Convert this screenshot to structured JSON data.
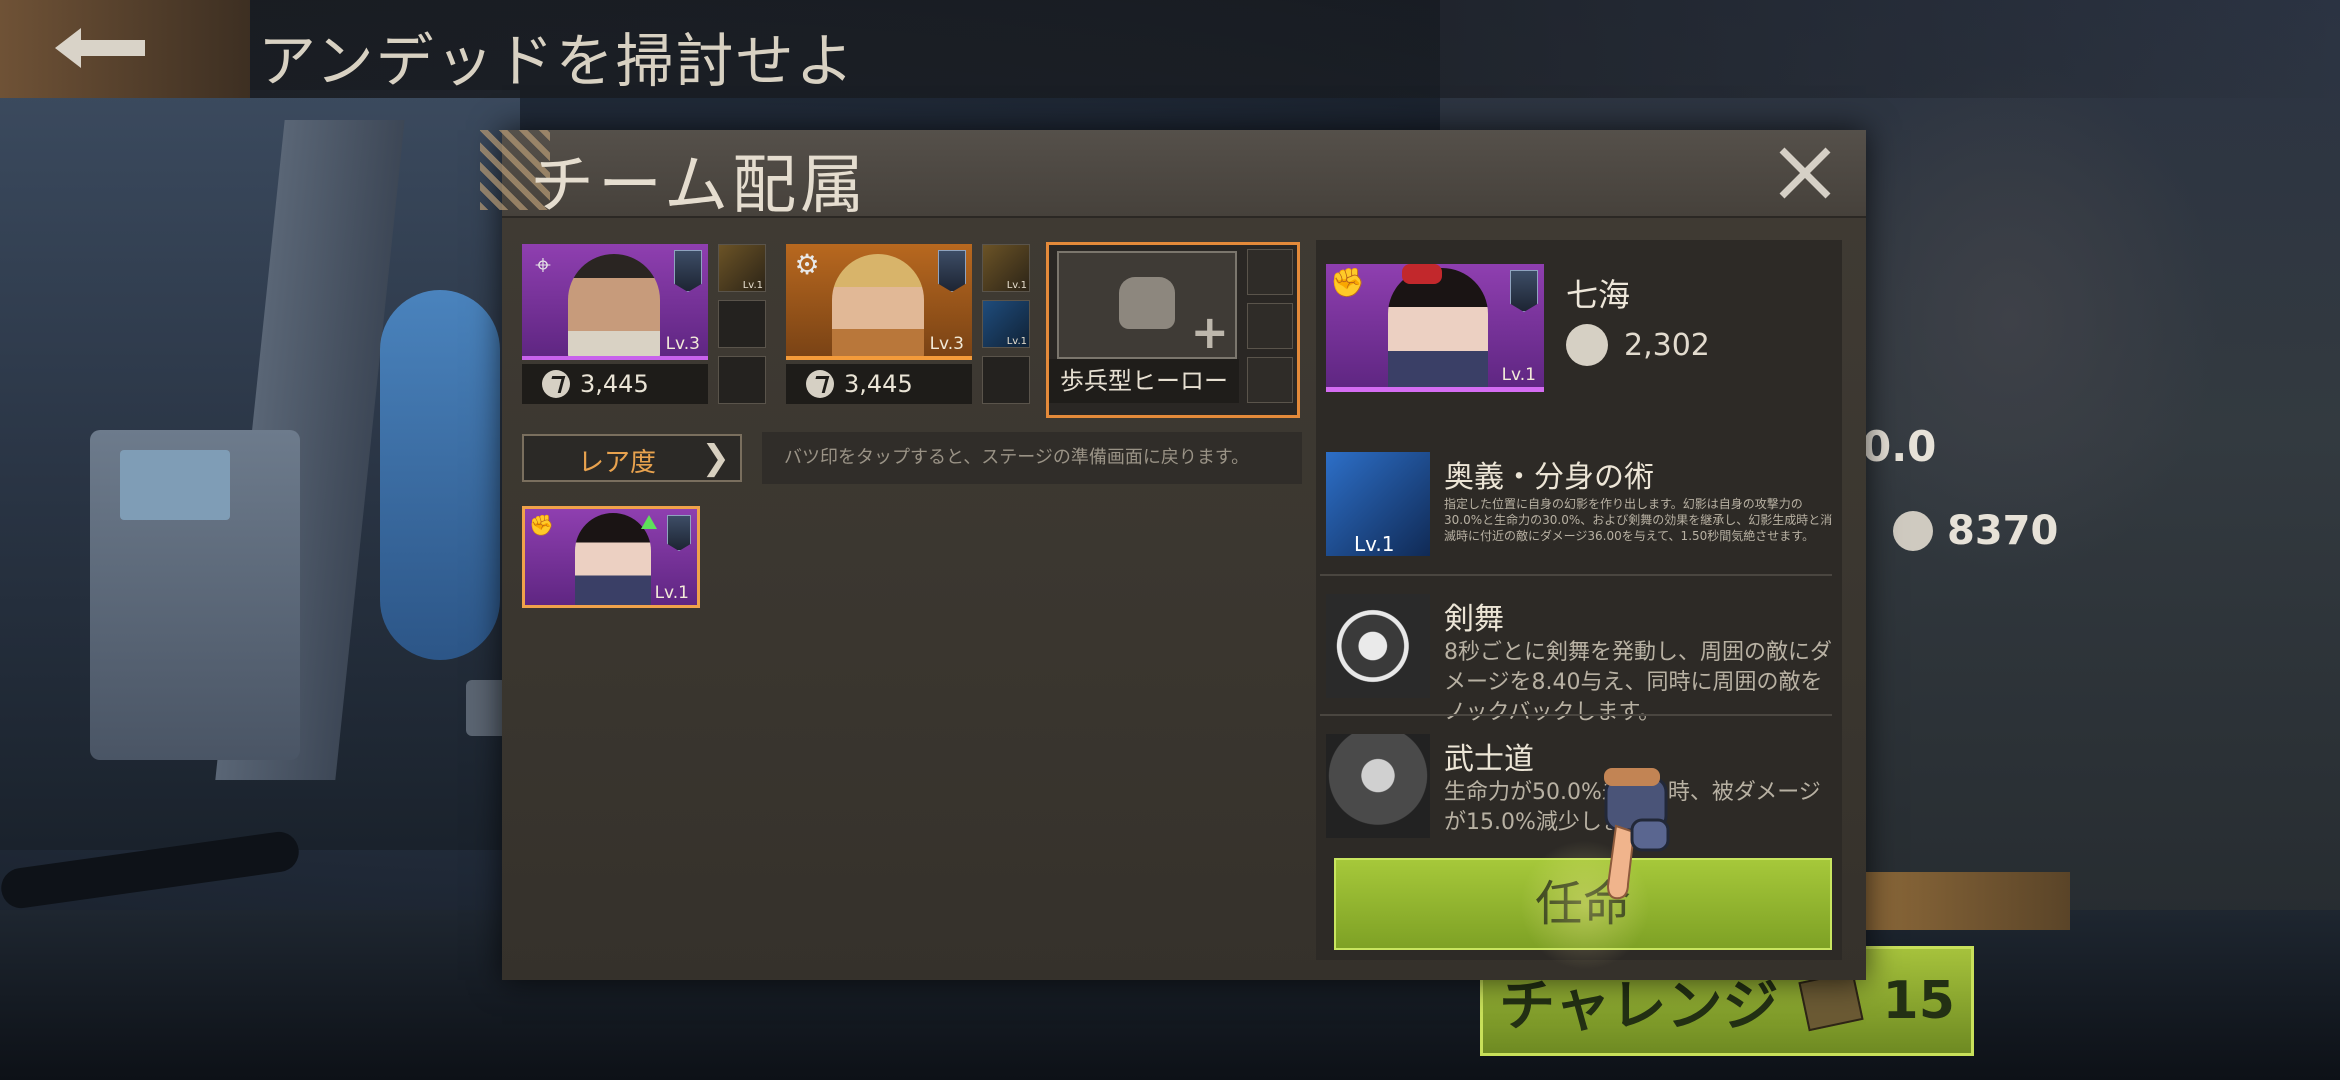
{
  "topbar": {
    "title": "アンデッドを掃討せよ"
  },
  "background": {
    "stat_partial": "0.0",
    "power_value": "8370",
    "challenge_label": "チャレンジ",
    "challenge_cost": "15"
  },
  "dialog": {
    "title": "チーム配属",
    "slots": [
      {
        "level": "Lv.3",
        "power": "3,445",
        "rarity_color": "#8f3fb0",
        "equip_levels": [
          "Lv.1",
          "",
          ""
        ]
      },
      {
        "level": "Lv.3",
        "power": "3,445",
        "rarity_color": "#b8681f",
        "equip_levels": [
          "Lv.1",
          "Lv.1",
          ""
        ]
      }
    ],
    "empty_slot": {
      "type_label": "歩兵型ヒーロー"
    },
    "filter": {
      "rarity_label": "レア度"
    },
    "hint": "バツ印をタップすると、ステージの準備画面に戻ります。",
    "roster": [
      {
        "level": "Lv.1"
      }
    ],
    "detail": {
      "name": "七海",
      "level": "Lv.1",
      "power": "2,302",
      "skills": [
        {
          "name": "奥義・分身の術",
          "level": "Lv.1",
          "desc": "指定した位置に自身の幻影を作り出します。幻影は自身の攻撃力の30.0%と生命力の30.0%、および剣舞の効果を継承し、幻影生成時と消滅時に付近の敵にダメージ36.00を与えて、1.50秒間気絶させます。"
        },
        {
          "name": "剣舞",
          "desc": "8秒ごとに剣舞を発動し、周囲の敵にダメージを8.40与え、同時に周囲の敵をノックバックします。"
        },
        {
          "name": "武士道",
          "desc": "生命力が50.0%未満の時、被ダメージが15.0%減少します。"
        }
      ],
      "appoint_label": "任命"
    }
  }
}
